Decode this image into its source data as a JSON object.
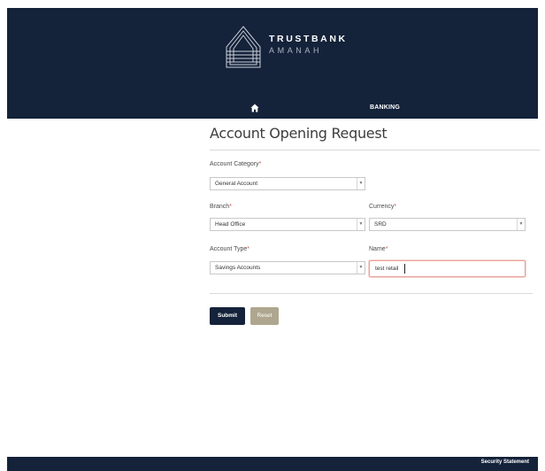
{
  "brand": {
    "name": "TRUSTBANK",
    "subname": "AMANAH",
    "logo_icon": "house-peak-logo-icon",
    "primary_color": "#14223a",
    "accent_color": "#aea68f"
  },
  "nav": {
    "home_icon": "home-icon",
    "banking_label": "BANKING"
  },
  "page": {
    "title": "Account Opening Request"
  },
  "form": {
    "account_category": {
      "label": "Account Category",
      "required_mark": "*",
      "value": "General Account"
    },
    "branch": {
      "label": "Branch",
      "required_mark": "*",
      "value": "Head Office"
    },
    "currency": {
      "label": "Currency",
      "required_mark": "*",
      "value": "SRD"
    },
    "account_type": {
      "label": "Account Type",
      "required_mark": "*",
      "value": "Savings Accounts"
    },
    "name": {
      "label": "Name",
      "required_mark": "*",
      "value": "test retail"
    }
  },
  "buttons": {
    "submit_label": "Submit",
    "reset_label": "Reset"
  },
  "footer": {
    "link_label": "Security Statement"
  }
}
